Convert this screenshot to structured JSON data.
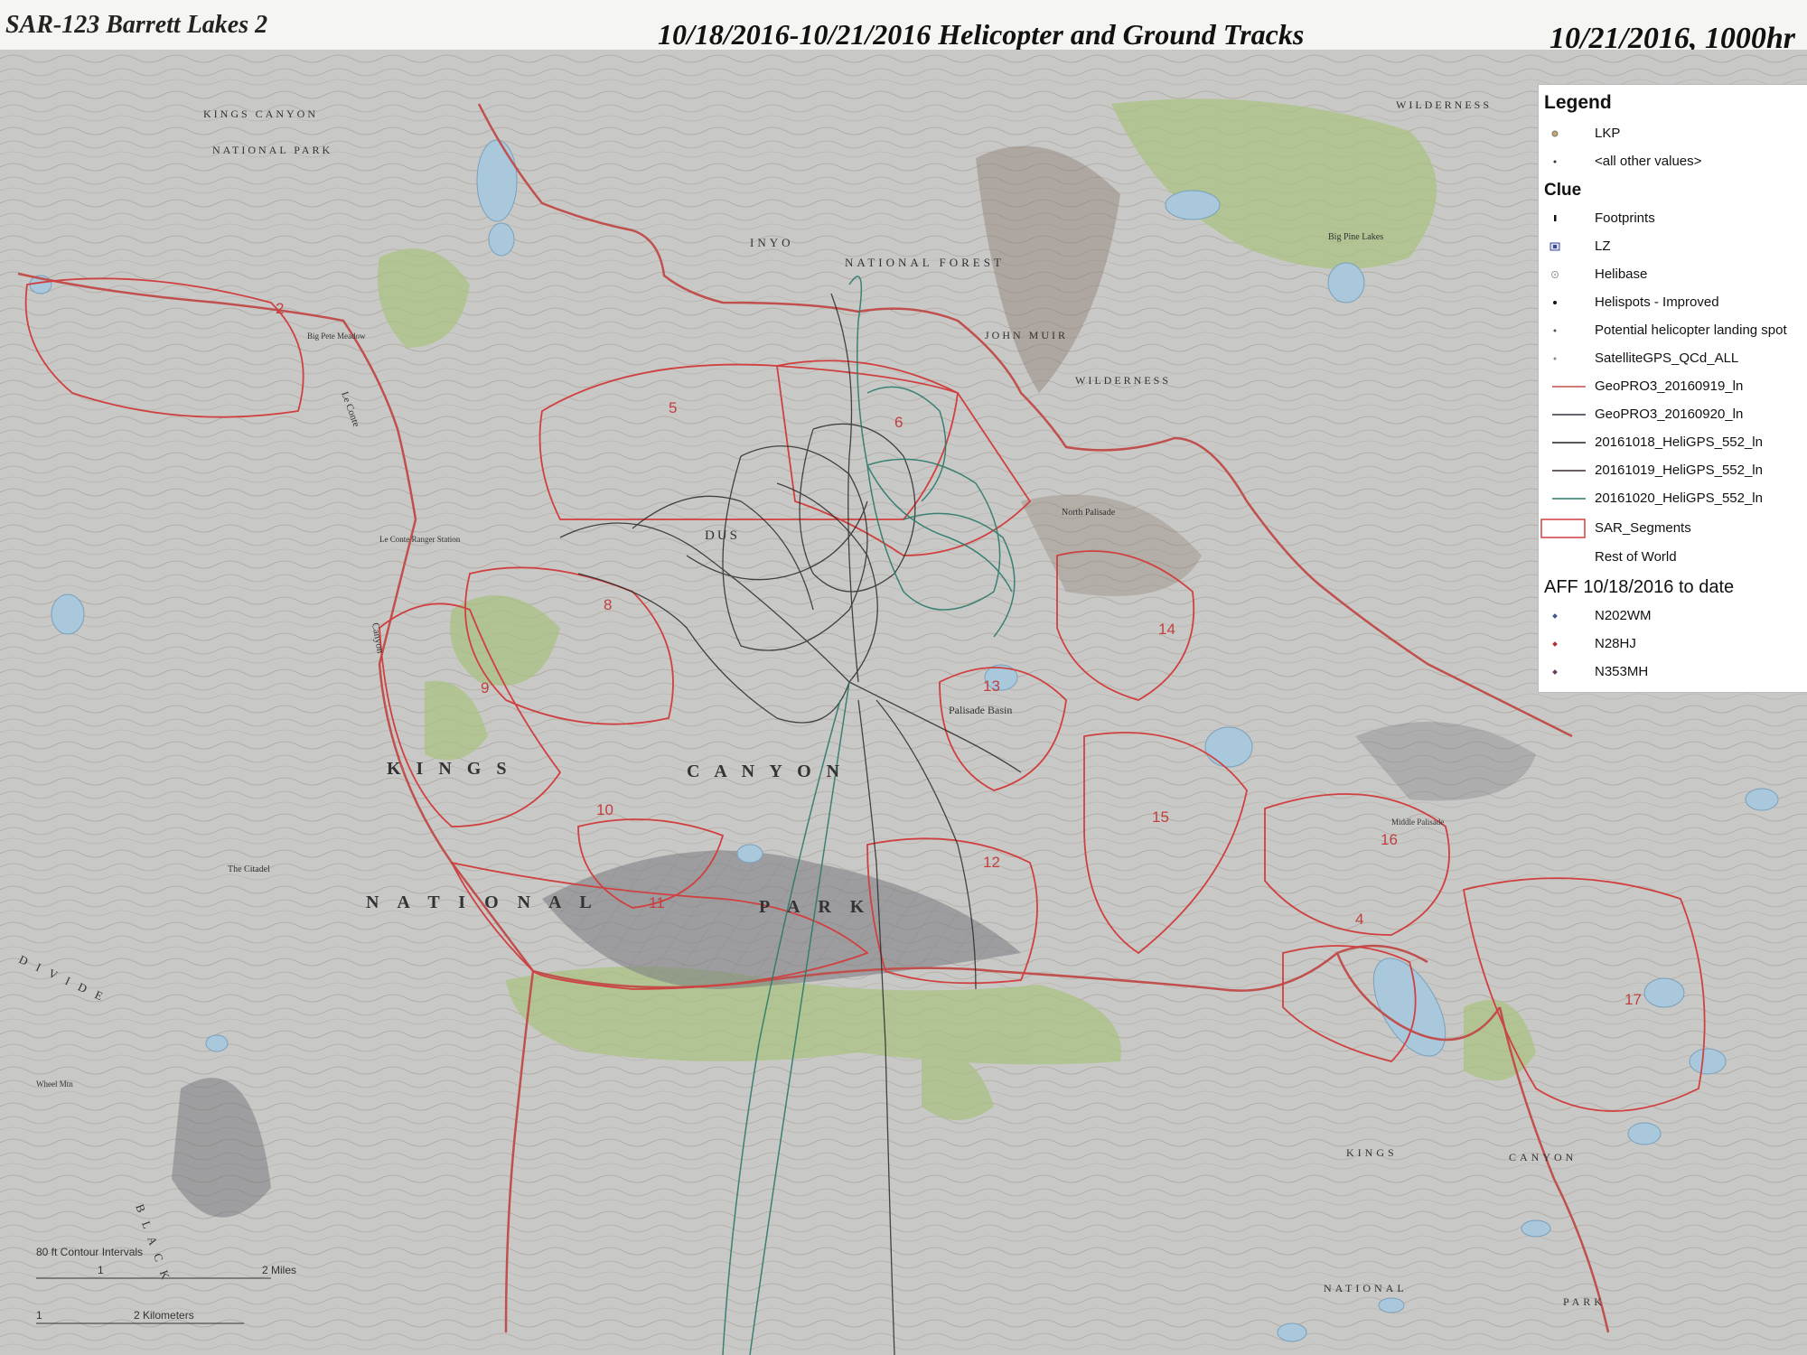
{
  "header": {
    "left_title": "SAR-123 Barrett Lakes 2",
    "center_title": "10/18/2016-10/21/2016 Helicopter and Ground Tracks",
    "right_title": "10/21/2016, 1000hr"
  },
  "map": {
    "place_labels": {
      "kings_canyon_top": "KINGS CANYON",
      "national_park_top": "NATIONAL PARK",
      "kings_main": "K I N G S",
      "canyon_main": "C A N Y O N",
      "national_main": "N A T I O N A L",
      "park_main": "P A R K",
      "inyo": "INYO",
      "national_forest": "NATIONAL FOREST",
      "john_muir": "JOHN MUIR",
      "wilderness_mid": "WILDERNESS",
      "wilderness_top": "WILDERNESS",
      "kings_br": "KINGS",
      "canyon_br": "CANYON",
      "national_br": "NATIONAL",
      "park_br": "PARK",
      "le_conte": "Le Conte",
      "canyon_side": "Canyon",
      "palisade_basin": "Palisade Basin",
      "big_pete_meadow": "Big Pete Meadow",
      "le_conte_ranger": "Le Conte Ranger Station",
      "north_palisade": "North Palisade",
      "dusy": "DUS",
      "divide": "D I V I D E",
      "black": "B L A C K",
      "wheel_mtn": "Wheel Mtn",
      "the_citadel": "The Citadel",
      "middle_palisade": "Middle Palisade",
      "big_pine_lakes": "Big Pine Lakes"
    },
    "segment_numbers": [
      "2",
      "5",
      "6",
      "8",
      "9",
      "10",
      "11",
      "12",
      "13",
      "14",
      "15",
      "16",
      "17",
      "4"
    ],
    "scale": {
      "contour_note": "80 ft Contour Intervals",
      "miles_0": "1",
      "miles_label": "2 Miles",
      "km_0": "1",
      "km_label": "2 Kilometers"
    }
  },
  "legend": {
    "title": "Legend",
    "items": [
      {
        "label": "LKP",
        "symbol": "lkp-dot",
        "color": "#c8a86a"
      },
      {
        "label": "<all other values>",
        "symbol": "small-dot",
        "color": "#333333"
      }
    ],
    "clue_title": "Clue",
    "clue_items": [
      {
        "label": "Footprints",
        "symbol": "footprint",
        "color": "#111111"
      },
      {
        "label": "LZ",
        "symbol": "lz-box",
        "color": "#3a4a9a"
      },
      {
        "label": "Helibase",
        "symbol": "helibase",
        "color": "#999999"
      },
      {
        "label": "Helispots - Improved",
        "symbol": "dot",
        "color": "#111111"
      },
      {
        "label": "Potential helicopter landing spot",
        "symbol": "dot-small",
        "color": "#555555"
      },
      {
        "label": "SatelliteGPS_QCd_ALL",
        "symbol": "dot-small",
        "color": "#888888"
      },
      {
        "label": "GeoPRO3_20160919_ln",
        "symbol": "line",
        "color": "#c0504d"
      },
      {
        "label": "GeoPRO3_20160920_ln",
        "symbol": "line",
        "color": "#333344"
      },
      {
        "label": "20161018_HeliGPS_552_ln",
        "symbol": "line",
        "color": "#222222"
      },
      {
        "label": "20161019_HeliGPS_552_ln",
        "symbol": "line",
        "color": "#3a2a30"
      },
      {
        "label": "20161020_HeliGPS_552_ln",
        "symbol": "line",
        "color": "#2a7a6a"
      },
      {
        "label": "SAR_Segments",
        "symbol": "box",
        "color": "#d04040"
      },
      {
        "label": "Rest of World",
        "symbol": "none",
        "color": "#ffffff"
      }
    ],
    "aff_title": "AFF 10/18/2016 to date",
    "aff_items": [
      {
        "label": "N202WM",
        "color": "#3a5a8a"
      },
      {
        "label": "N28HJ",
        "color": "#b03030"
      },
      {
        "label": "N353MH",
        "color": "#6a3a5a"
      }
    ]
  },
  "colors": {
    "terrain_base": "#c9c9c6",
    "forest_green": "#9fbf7a",
    "lake_blue": "#a9c8dc",
    "contour": "#8a7a6a",
    "road_red": "#c0504d",
    "heli_green": "#2a7a6a",
    "heli_dark": "#2a2a2a"
  }
}
